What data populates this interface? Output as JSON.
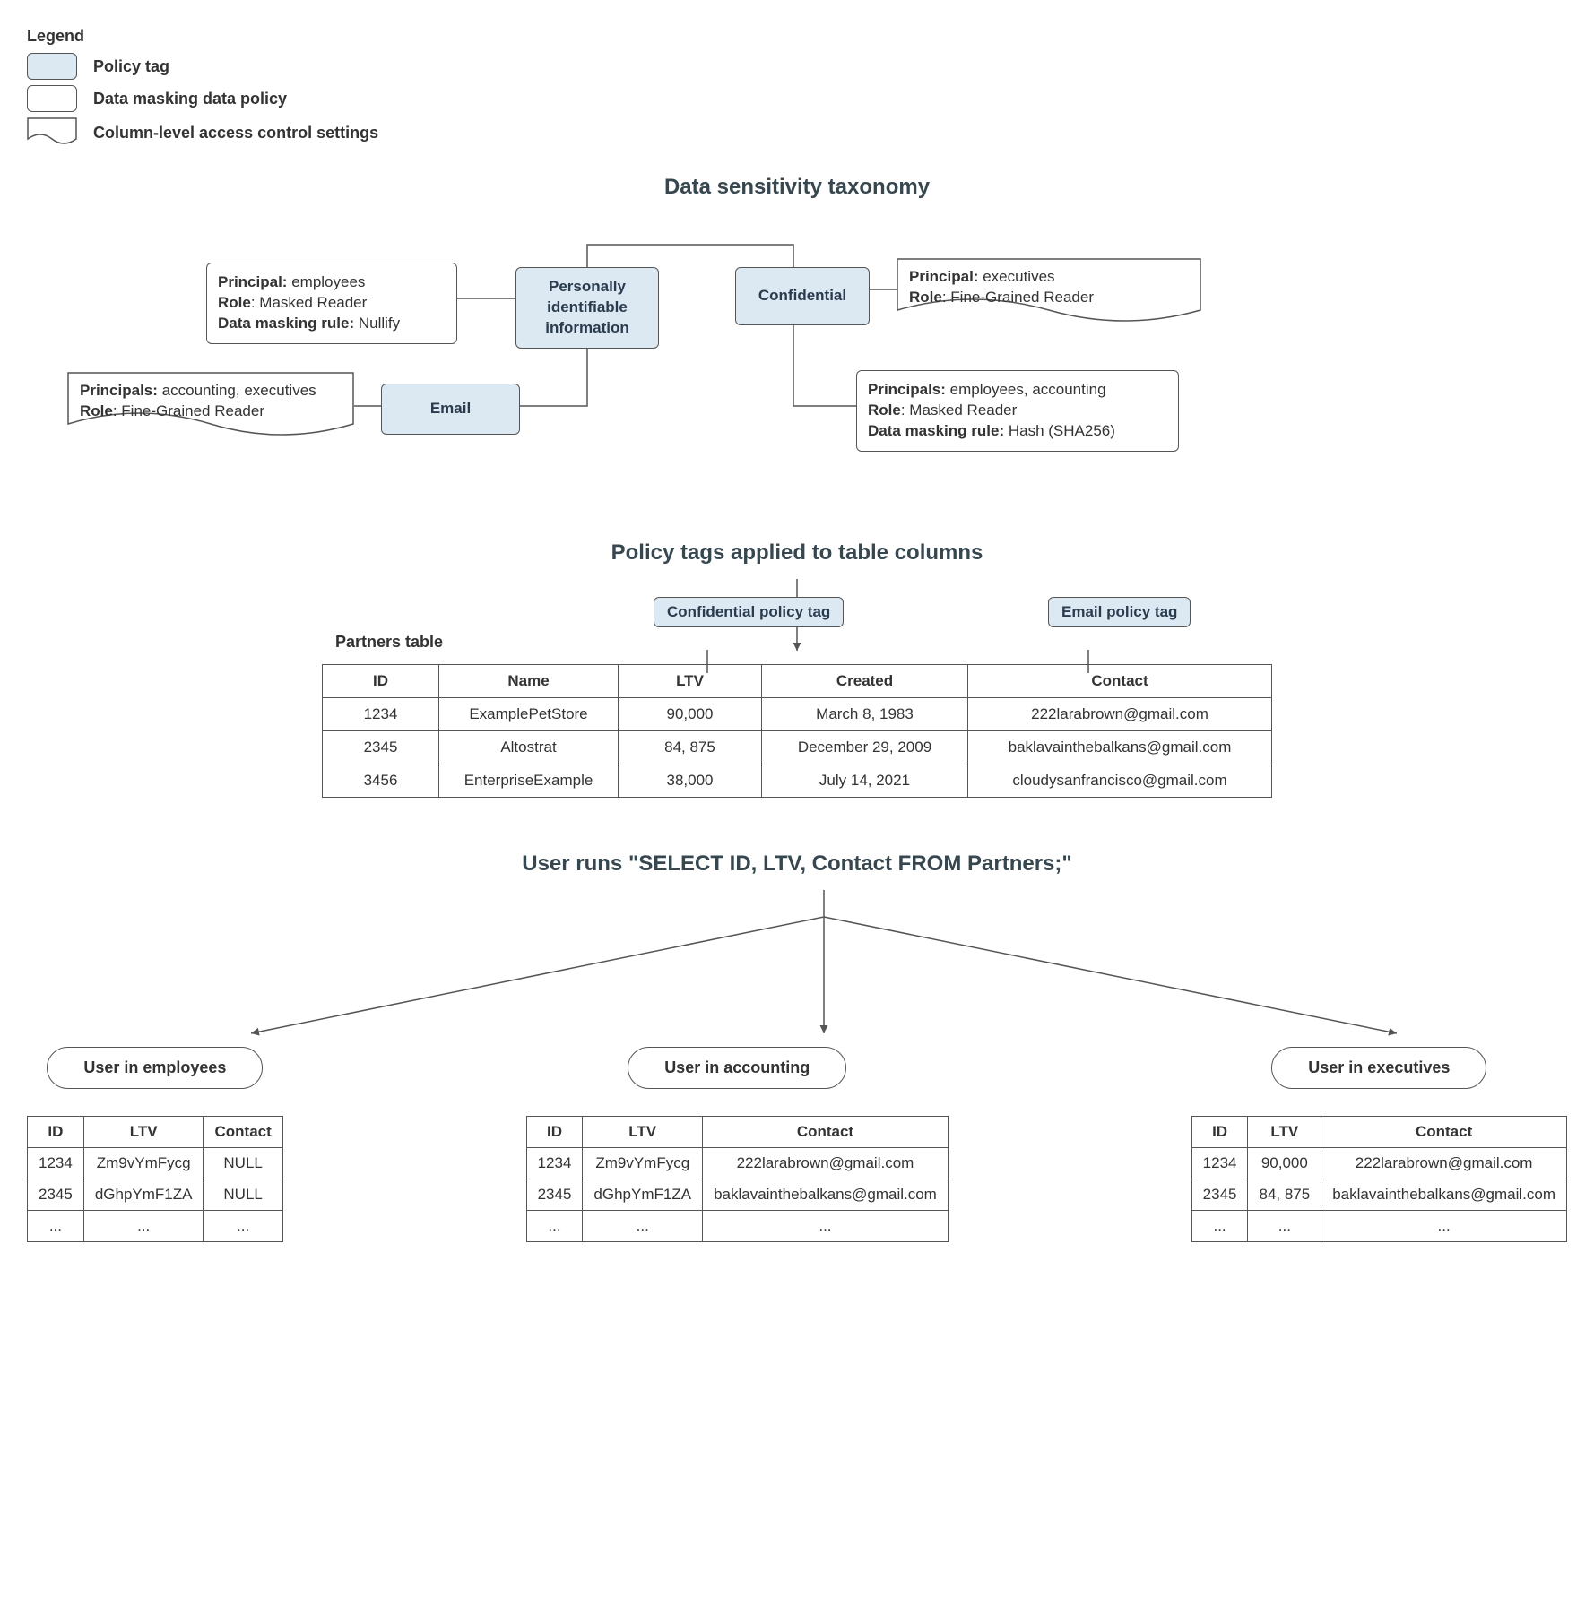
{
  "legend": {
    "title": "Legend",
    "items": [
      "Policy tag",
      "Data masking data policy",
      "Column-level access control settings"
    ]
  },
  "section_titles": {
    "taxonomy": "Data sensitivity taxonomy",
    "applied": "Policy tags applied to table columns",
    "query": "User runs \"SELECT ID, LTV, Contact FROM Partners;\""
  },
  "tags": {
    "pii": "Personally identifiable information",
    "confidential": "Confidential",
    "email": "Email"
  },
  "pii_policy": {
    "principal_label": "Principal:",
    "principal": "employees",
    "role_label": "Role",
    "role": "Masked Reader",
    "rule_label": "Data masking rule:",
    "rule": "Nullify"
  },
  "email_access": {
    "principals_label": "Principals:",
    "principals": "accounting, executives",
    "role_label": "Role",
    "role": "Fine-Grained Reader"
  },
  "conf_access": {
    "principal_label": "Principal:",
    "principal": "executives",
    "role_label": "Role",
    "role": "Fine-Grained Reader"
  },
  "conf_policy": {
    "principals_label": "Principals:",
    "principals": "employees, accounting",
    "role_label": "Role",
    "role": "Masked Reader",
    "rule_label": "Data masking rule:",
    "rule": "Hash (SHA256)"
  },
  "chips": {
    "confidential": "Confidential policy tag",
    "email": "Email policy tag"
  },
  "partners": {
    "label": "Partners table",
    "headers": [
      "ID",
      "Name",
      "LTV",
      "Created",
      "Contact"
    ],
    "rows": [
      [
        "1234",
        "ExamplePetStore",
        "90,000",
        "March 8, 1983",
        "222larabrown@gmail.com"
      ],
      [
        "2345",
        "Altostrat",
        "84, 875",
        "December 29, 2009",
        "baklavainthebalkans@gmail.com"
      ],
      [
        "3456",
        "EnterpriseExample",
        "38,000",
        "July 14, 2021",
        "cloudysanfrancisco@gmail.com"
      ]
    ]
  },
  "results": {
    "headers": [
      "ID",
      "LTV",
      "Contact"
    ],
    "employees": {
      "label": "User in employees",
      "rows": [
        [
          "1234",
          "Zm9vYmFycg",
          "NULL"
        ],
        [
          "2345",
          "dGhpYmF1ZA",
          "NULL"
        ],
        [
          "...",
          "...",
          "..."
        ]
      ]
    },
    "accounting": {
      "label": "User in accounting",
      "rows": [
        [
          "1234",
          "Zm9vYmFycg",
          "222larabrown@gmail.com"
        ],
        [
          "2345",
          "dGhpYmF1ZA",
          "baklavainthebalkans@gmail.com"
        ],
        [
          "...",
          "...",
          "..."
        ]
      ]
    },
    "executives": {
      "label": "User in executives",
      "rows": [
        [
          "1234",
          "90,000",
          "222larabrown@gmail.com"
        ],
        [
          "2345",
          "84, 875",
          "baklavainthebalkans@gmail.com"
        ],
        [
          "...",
          "...",
          "..."
        ]
      ]
    }
  }
}
